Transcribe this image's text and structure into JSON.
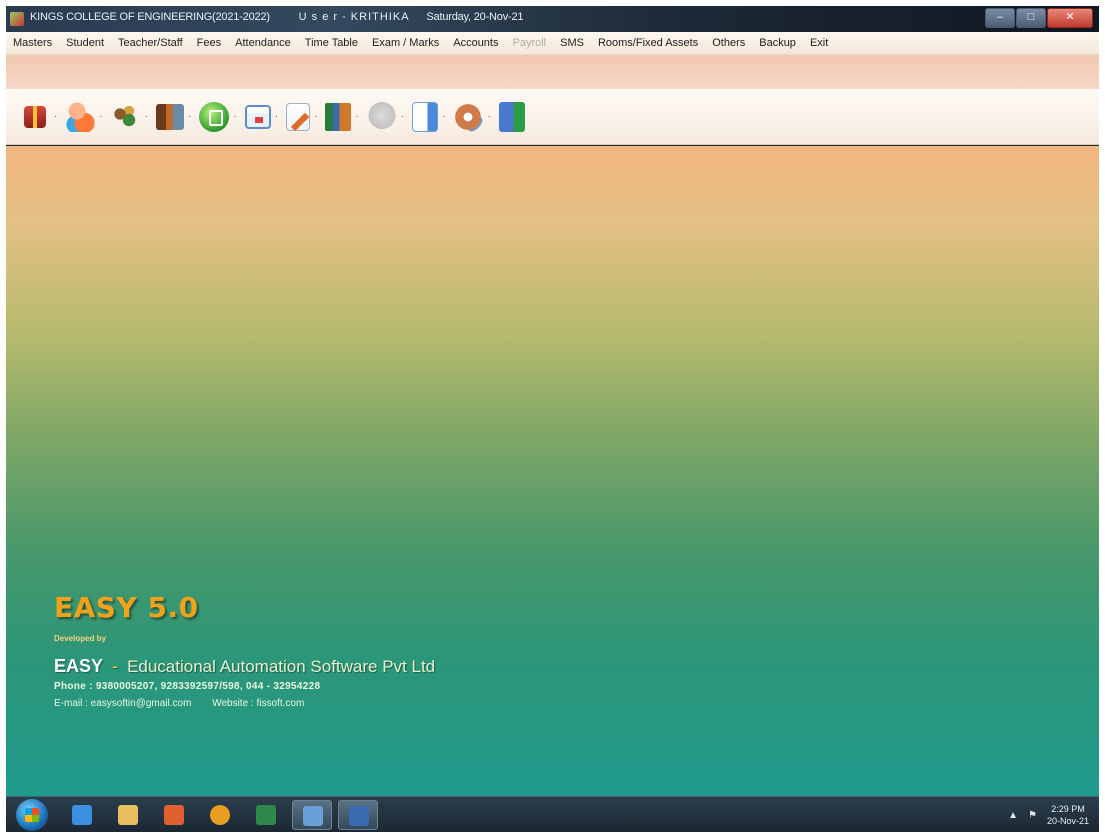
{
  "window": {
    "title": "KINGS COLLEGE OF ENGINEERING(2021-2022)",
    "user": "U s e r - KRITHIKA",
    "date": "Saturday, 20-Nov-21",
    "buttons": {
      "minimize": "–",
      "maximize": "□",
      "close": "✕"
    }
  },
  "menu": [
    {
      "label": "Masters",
      "enabled": true
    },
    {
      "label": "Student",
      "enabled": true
    },
    {
      "label": "Teacher/Staff",
      "enabled": true
    },
    {
      "label": "Fees",
      "enabled": true
    },
    {
      "label": "Attendance",
      "enabled": true
    },
    {
      "label": "Time Table",
      "enabled": true
    },
    {
      "label": "Exam / Marks",
      "enabled": true
    },
    {
      "label": "Accounts",
      "enabled": true
    },
    {
      "label": "Payroll",
      "enabled": false
    },
    {
      "label": "SMS",
      "enabled": true
    },
    {
      "label": "Rooms/Fixed Assets",
      "enabled": true
    },
    {
      "label": "Others",
      "enabled": true
    },
    {
      "label": "Backup",
      "enabled": true
    },
    {
      "label": "Exit",
      "enabled": true
    }
  ],
  "toolbar": {
    "dropdown_glyph": "·",
    "icons": [
      {
        "name": "gift-icon",
        "cls": "gift"
      },
      {
        "name": "student-people-icon",
        "cls": "people"
      },
      {
        "name": "staff-group-icon",
        "cls": "group"
      },
      {
        "name": "fees-money-icon",
        "cls": "money"
      },
      {
        "name": "attendance-icon",
        "cls": "green"
      },
      {
        "name": "calendar-icon",
        "cls": "calendar"
      },
      {
        "name": "exam-pen-icon",
        "cls": "pen"
      },
      {
        "name": "accounts-books-icon",
        "cls": "books"
      },
      {
        "name": "payroll-disabled-icon",
        "cls": "fade"
      },
      {
        "name": "sms-document-icon",
        "cls": "doc"
      },
      {
        "name": "settings-gear-icon",
        "cls": "gear"
      },
      {
        "name": "exit-door-icon",
        "cls": "exit"
      }
    ]
  },
  "branding": {
    "product": "EASY 5.0",
    "developed_by": "Developed by",
    "company_short": "EASY",
    "company_dash": "-",
    "company_full": "Educational Automation Software Pvt Ltd",
    "phone": "Phone : 9380005207, 9283392597/598, 044 - 32954228",
    "email": "E-mail : easysoftin@gmail.com",
    "website": "Website : fissoft.com"
  },
  "taskbar": {
    "items": [
      {
        "name": "ie-icon",
        "color": "#3a8fe0"
      },
      {
        "name": "file-explorer-icon",
        "color": "#e8c060"
      },
      {
        "name": "media-player-icon",
        "color": "#e06030"
      },
      {
        "name": "chrome-icon",
        "color": "#e8a020"
      },
      {
        "name": "excel-icon",
        "color": "#2d8a4a"
      },
      {
        "name": "easy-app-icon",
        "color": "#6aa0d8"
      },
      {
        "name": "word-app-icon",
        "color": "#3a6ab0"
      }
    ],
    "tray_chevron": "▲",
    "tray_flag": "⚑",
    "clock_time": "2:29 PM",
    "clock_date": "20-Nov-21"
  }
}
